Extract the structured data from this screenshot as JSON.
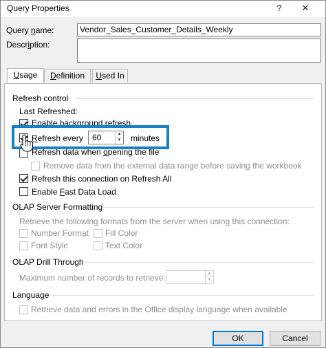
{
  "window": {
    "title": "Query Properties",
    "help_glyph": "?",
    "close_glyph": "✕"
  },
  "query": {
    "name_label_pre": "Query ",
    "name_label_u": "n",
    "name_label_post": "ame:",
    "name_value": "Vendor_Sales_Customer_Details_Weekly",
    "desc_label_pre": "Descr",
    "desc_label_u": "i",
    "desc_label_post": "ption:",
    "desc_value": ""
  },
  "tabs": [
    {
      "pre": "",
      "u": "U",
      "post": "sage"
    },
    {
      "pre": "",
      "u": "D",
      "post": "efinition"
    },
    {
      "pre": "",
      "u": "U",
      "post": "sed In"
    }
  ],
  "refresh_control": {
    "heading": "Refresh control",
    "last_refreshed": "Last Refreshed:",
    "enable_background_pre": "Enable background refresh",
    "refresh_every_pre": "",
    "refresh_every_u": "R",
    "refresh_every_post": "efresh every",
    "refresh_minutes_value": "60",
    "minutes_label": "minutes",
    "refresh_open_pre": "Refresh data when ",
    "refresh_open_u": "o",
    "refresh_open_post": "pening the file",
    "remove_data": "Remove data from the external data range before saving the workbook",
    "refresh_all": "Refresh this connection on Refresh All",
    "fast_load_pre": "Enable ",
    "fast_load_u": "F",
    "fast_load_post": "ast Data Load"
  },
  "olap_formatting": {
    "heading": "OLAP Server Formatting",
    "intro": "Retrieve the following formats from the server when using this connection:",
    "number_format": "Number Format",
    "fill_color": "Fill Color",
    "font_style": "Font Style",
    "text_color": "Text Color"
  },
  "olap_drill": {
    "heading": "OLAP Drill Through",
    "max_records": "Maximum number of records to retrieve:",
    "max_records_value": ""
  },
  "language": {
    "heading": "Language",
    "retrieve": "Retrieve data and errors in the Office display language when available"
  },
  "buttons": {
    "ok": "OK",
    "cancel": "Cancel"
  },
  "colors": {
    "highlight": "#1a7fc9",
    "default_button_border": "#0078d7"
  },
  "state": {
    "enable_background_refresh": true,
    "refresh_every": true,
    "refresh_on_open": false,
    "remove_data": false,
    "refresh_all": true,
    "fast_data_load": false
  }
}
